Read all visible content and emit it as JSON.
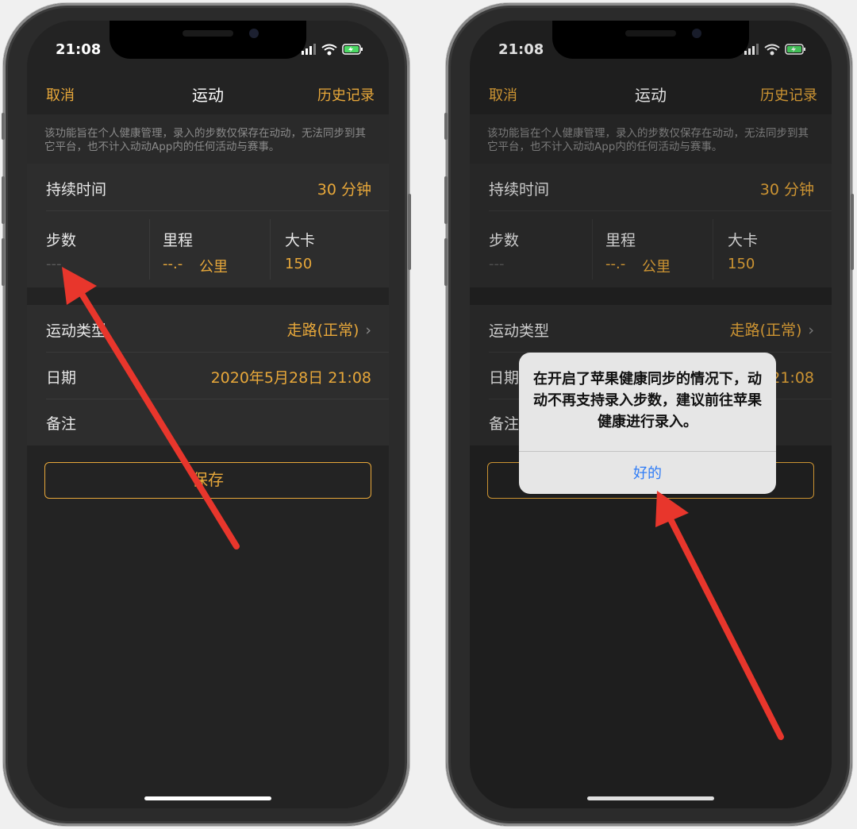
{
  "status": {
    "time": "21:08"
  },
  "nav": {
    "cancel_label": "取消",
    "title": "运动",
    "history_label": "历史记录"
  },
  "notice": "该功能旨在个人健康管理，录入的步数仅保存在动动，无法同步到其它平台，也不计入动动App内的任何活动与赛事。",
  "duration": {
    "label": "持续时间",
    "value": "30 分钟"
  },
  "metrics": {
    "steps": {
      "label": "步数",
      "value": "---"
    },
    "distance": {
      "label": "里程",
      "value": "--.-",
      "unit": "公里"
    },
    "calories": {
      "label": "大卡",
      "value": "150"
    }
  },
  "exercise_type": {
    "label": "运动类型",
    "value": "走路(正常)"
  },
  "date": {
    "label": "日期",
    "value": "2020年5月28日 21:08"
  },
  "note": {
    "label": "备注"
  },
  "save_label": "保存",
  "alert": {
    "message": "在开启了苹果健康同步的情况下，动动不再支持录入步数，建议前往苹果健康进行录入。",
    "ok_label": "好的"
  },
  "colors": {
    "accent": "#e8a83a",
    "background": "#232323",
    "link_blue": "#2f7cf6",
    "arrow_red": "#e8362c"
  }
}
